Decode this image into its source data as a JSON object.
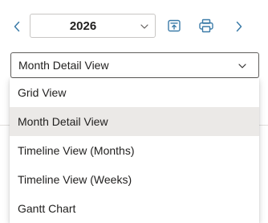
{
  "toolbar": {
    "prev_icon": "chevron-left-icon",
    "next_icon": "chevron-right-icon",
    "year": "2026",
    "year_dropdown_icon": "chevron-down-icon",
    "today_icon": "go-to-today-icon",
    "print_icon": "printer-icon"
  },
  "view_selector": {
    "selected": "Month Detail View",
    "dropdown_icon": "chevron-down-icon",
    "options": [
      {
        "label": "Grid View",
        "selected": false
      },
      {
        "label": "Month Detail View",
        "selected": true
      },
      {
        "label": "Timeline View (Months)",
        "selected": false
      },
      {
        "label": "Timeline View (Weeks)",
        "selected": false
      },
      {
        "label": "Gantt Chart",
        "selected": false
      }
    ]
  },
  "colors": {
    "accent": "#3b7ba8",
    "selected_option_bg": "#ebe9e7",
    "text": "#201f1e",
    "border": "#c8c6c4"
  }
}
